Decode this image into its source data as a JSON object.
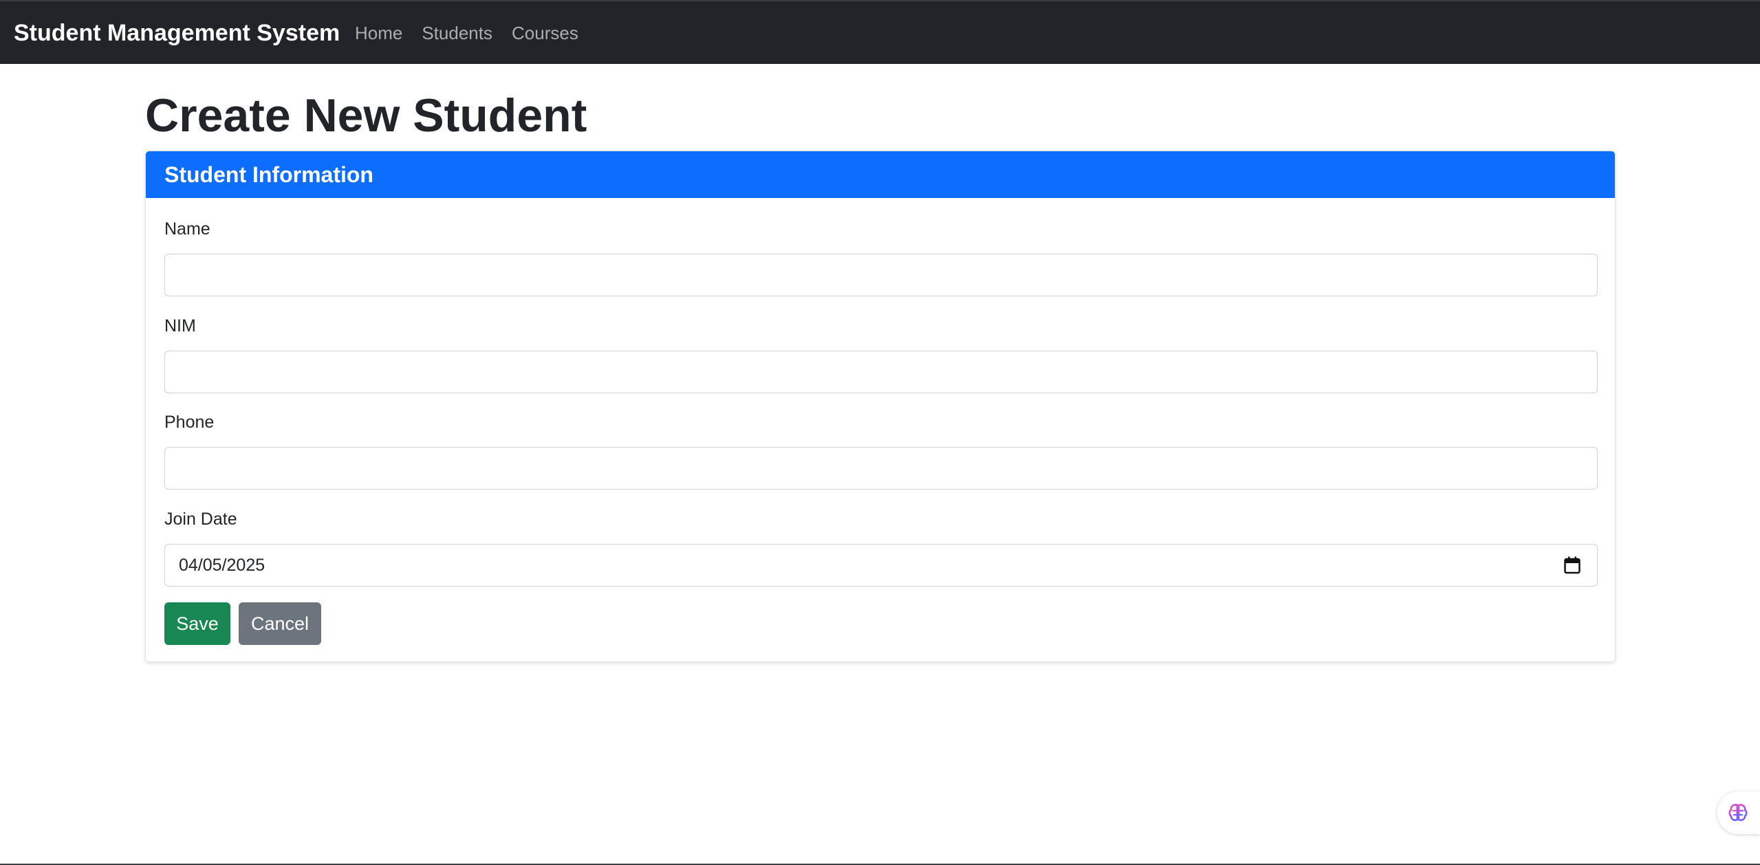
{
  "navbar": {
    "brand": "Student Management System",
    "links": [
      {
        "label": "Home"
      },
      {
        "label": "Students"
      },
      {
        "label": "Courses"
      }
    ]
  },
  "page": {
    "title": "Create New Student"
  },
  "card": {
    "header": "Student Information",
    "fields": {
      "name": {
        "label": "Name",
        "value": "",
        "placeholder": ""
      },
      "nim": {
        "label": "NIM",
        "value": "",
        "placeholder": ""
      },
      "phone": {
        "label": "Phone",
        "value": "",
        "placeholder": ""
      },
      "join_date": {
        "label": "Join Date",
        "value": "04/05/2025"
      }
    },
    "buttons": {
      "save": "Save",
      "cancel": "Cancel"
    }
  },
  "icons": {
    "calendar": "calendar-icon",
    "widget": "brain-icon"
  },
  "colors": {
    "navbar_bg": "#212529",
    "card_header_bg": "#0d6efd",
    "save_bg": "#198754",
    "cancel_bg": "#6c757d"
  }
}
